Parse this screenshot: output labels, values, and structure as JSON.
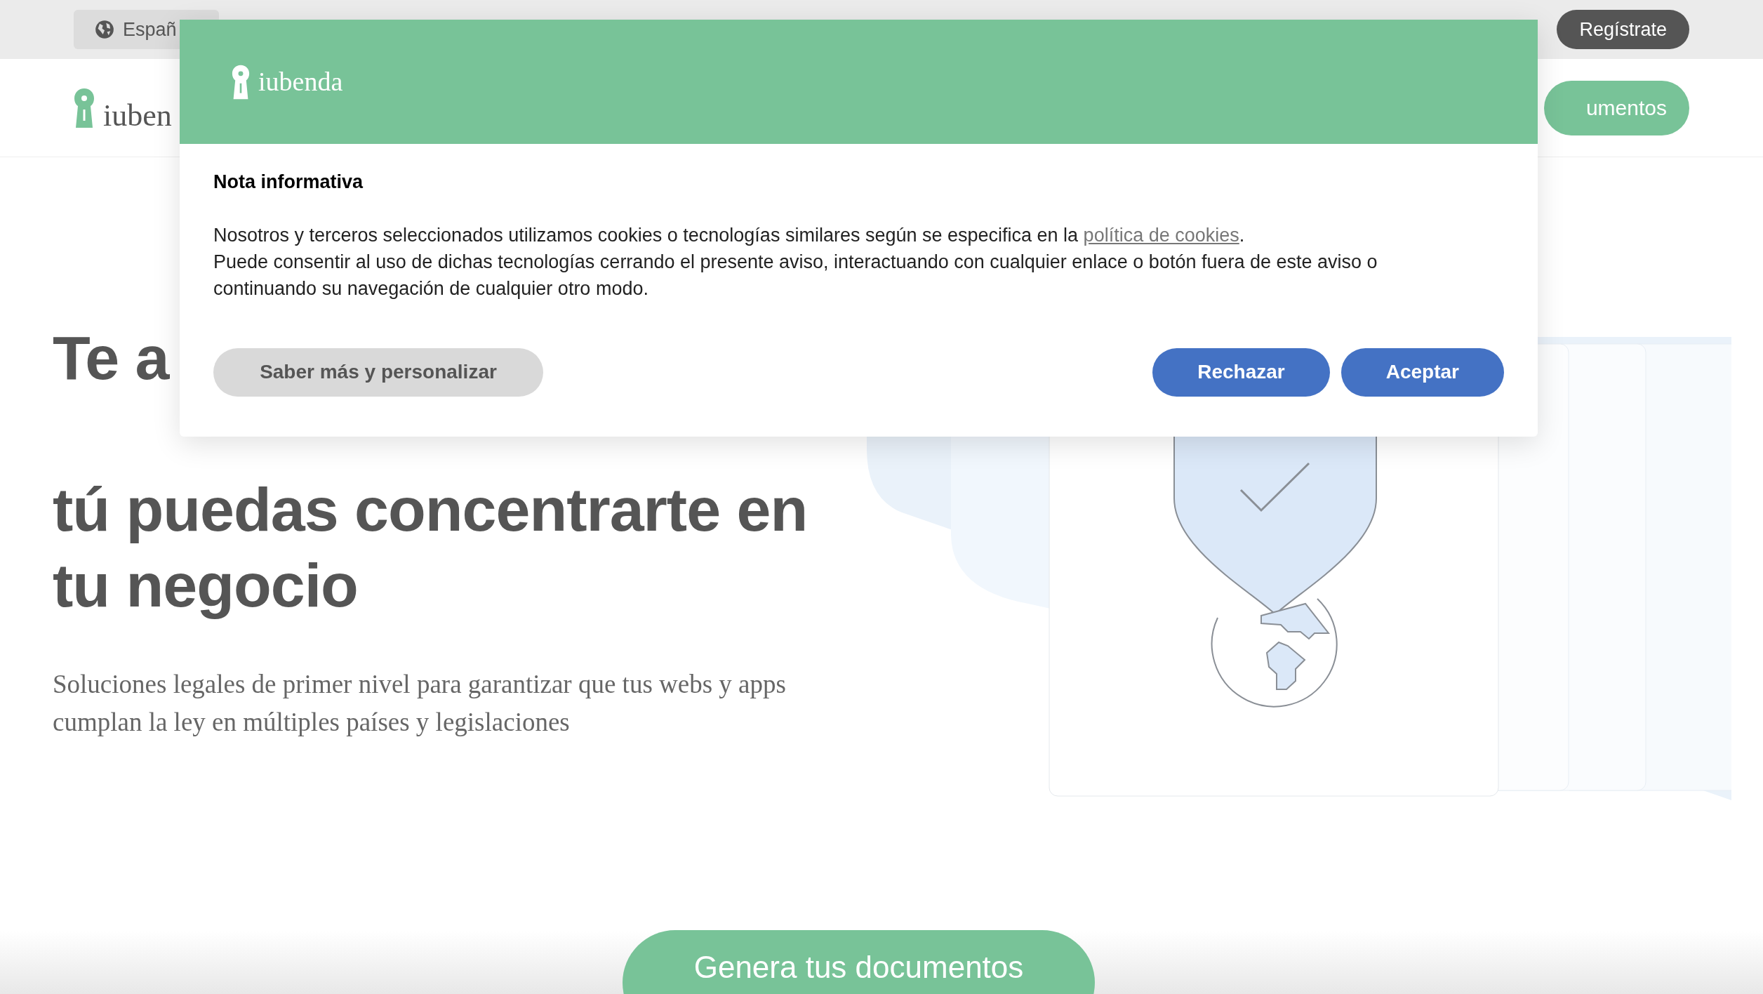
{
  "top_bar": {
    "language_button": "Españ",
    "register_button": "Regístrate"
  },
  "nav": {
    "logo_text": "iuben",
    "cta_button": "umentos"
  },
  "hero": {
    "heading_start": "Te a",
    "heading_lines": [
      "tú puedas concentrarte en",
      "tu negocio"
    ],
    "subtitle": "Soluciones legales de primer nivel para garantizar que tus webs y apps cumplan la ley en múltiples países y legislaciones",
    "cta_button": "Genera tus documentos"
  },
  "cookie_dialog": {
    "logo_text": "iubenda",
    "title": "Nota informativa",
    "notice": {
      "text_before": "Nosotros y terceros seleccionados utilizamos cookies o tecnologías similares según se especifica en la ",
      "link": "política de cookies",
      "text_after": "."
    },
    "consent_text": "Puede consentir al uso de dichas tecnologías cerrando el presente aviso, interactuando con cualquier enlace o botón fuera de este aviso o continuando su navegación de cualquier otro modo.",
    "buttons": [
      {
        "label": "Saber más y personalizar",
        "kind": "secondary"
      },
      {
        "label": "Rechazar",
        "kind": "primary"
      },
      {
        "label": "Aceptar",
        "kind": "primary"
      }
    ]
  }
}
